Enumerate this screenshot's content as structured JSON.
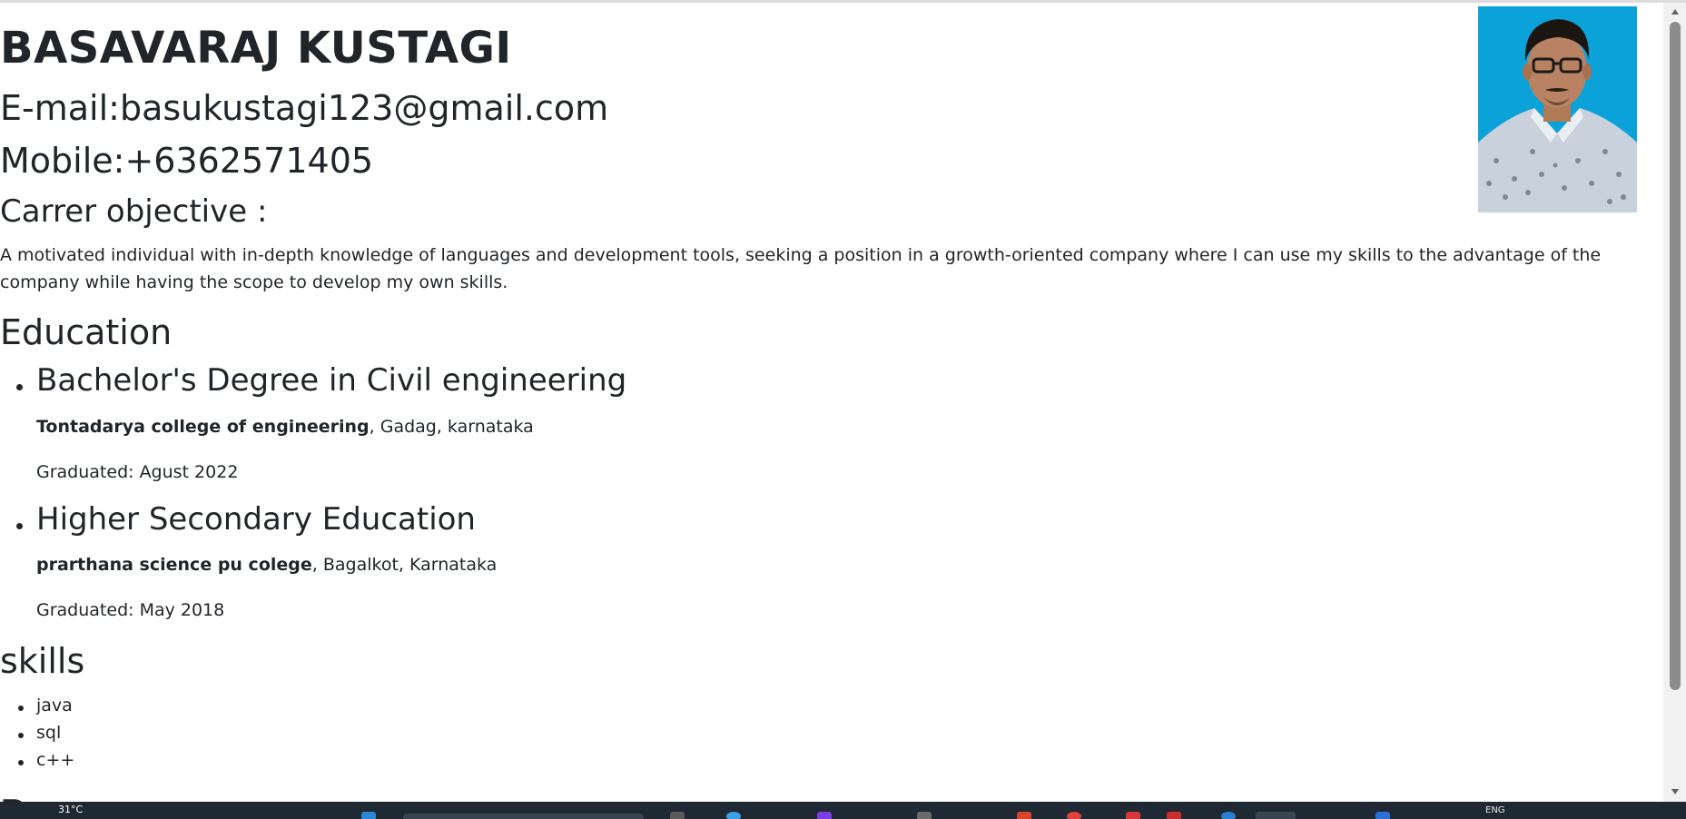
{
  "header": {
    "name": "BASAVARAJ KUSTAGI",
    "email": "E-mail:basukustagi123@gmail.com",
    "mobile": "Mobile:+6362571405"
  },
  "objective": {
    "heading": "Carrer objective :",
    "text": "A motivated individual with in-depth knowledge of languages and development tools, seeking a position in a growth-oriented company where I can use my skills to the advantage of the company while having the scope to develop my own skills."
  },
  "education": {
    "heading": "Education",
    "items": [
      {
        "degree": "Bachelor's Degree in Civil engineering",
        "institution": "Tontadarya college of engineering",
        "location": ", Gadag, karnataka",
        "graduated": "Graduated: Agust 2022"
      },
      {
        "degree": "Higher Secondary Education",
        "institution": "prarthana science pu colege",
        "location": ", Bagalkot, Karnataka",
        "graduated": "Graduated: May 2018"
      }
    ]
  },
  "skills": {
    "heading": "skills",
    "items": [
      "java",
      "sql",
      "c++"
    ]
  },
  "next_section": {
    "heading_partial": "P"
  },
  "taskbar": {
    "temperature": "31°C",
    "language": "ENG"
  },
  "colors": {
    "text": "#212529",
    "photo_background": "#0aa2d9",
    "taskbar": "#1f2933",
    "scrollbar_thumb": "#8c8c8c"
  }
}
